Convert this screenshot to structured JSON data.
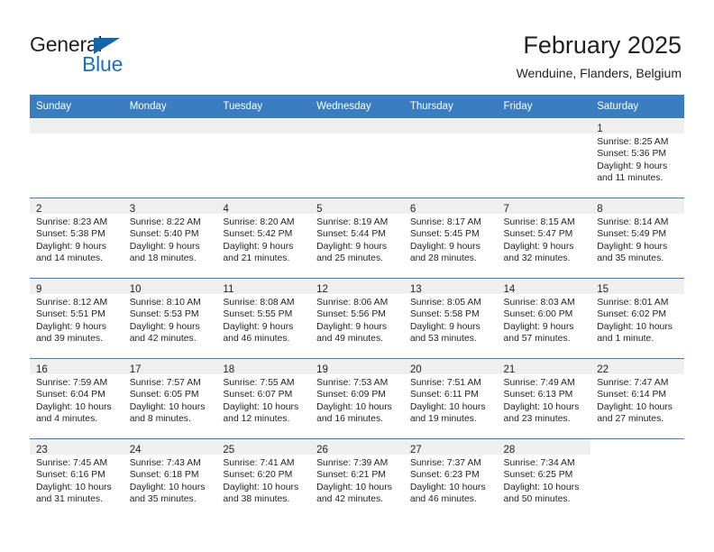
{
  "brand": {
    "name_part1": "General",
    "name_part2": "Blue",
    "color_dark": "#231f20",
    "color_blue": "#1f6fc0"
  },
  "header": {
    "title": "February 2025",
    "subtitle": "Wenduine, Flanders, Belgium"
  },
  "calendar": {
    "header_color": "#3a7dc0",
    "daynum_band_color": "#efefef",
    "weekdays": [
      "Sunday",
      "Monday",
      "Tuesday",
      "Wednesday",
      "Thursday",
      "Friday",
      "Saturday"
    ],
    "weeks": [
      [
        {
          "day": "",
          "blank": true
        },
        {
          "day": "",
          "blank": true
        },
        {
          "day": "",
          "blank": true
        },
        {
          "day": "",
          "blank": true
        },
        {
          "day": "",
          "blank": true
        },
        {
          "day": "",
          "blank": true
        },
        {
          "day": "1",
          "sunrise": "Sunrise: 8:25 AM",
          "sunset": "Sunset: 5:36 PM",
          "daylight": "Daylight: 9 hours and 11 minutes."
        }
      ],
      [
        {
          "day": "2",
          "sunrise": "Sunrise: 8:23 AM",
          "sunset": "Sunset: 5:38 PM",
          "daylight": "Daylight: 9 hours and 14 minutes."
        },
        {
          "day": "3",
          "sunrise": "Sunrise: 8:22 AM",
          "sunset": "Sunset: 5:40 PM",
          "daylight": "Daylight: 9 hours and 18 minutes."
        },
        {
          "day": "4",
          "sunrise": "Sunrise: 8:20 AM",
          "sunset": "Sunset: 5:42 PM",
          "daylight": "Daylight: 9 hours and 21 minutes."
        },
        {
          "day": "5",
          "sunrise": "Sunrise: 8:19 AM",
          "sunset": "Sunset: 5:44 PM",
          "daylight": "Daylight: 9 hours and 25 minutes."
        },
        {
          "day": "6",
          "sunrise": "Sunrise: 8:17 AM",
          "sunset": "Sunset: 5:45 PM",
          "daylight": "Daylight: 9 hours and 28 minutes."
        },
        {
          "day": "7",
          "sunrise": "Sunrise: 8:15 AM",
          "sunset": "Sunset: 5:47 PM",
          "daylight": "Daylight: 9 hours and 32 minutes."
        },
        {
          "day": "8",
          "sunrise": "Sunrise: 8:14 AM",
          "sunset": "Sunset: 5:49 PM",
          "daylight": "Daylight: 9 hours and 35 minutes."
        }
      ],
      [
        {
          "day": "9",
          "sunrise": "Sunrise: 8:12 AM",
          "sunset": "Sunset: 5:51 PM",
          "daylight": "Daylight: 9 hours and 39 minutes."
        },
        {
          "day": "10",
          "sunrise": "Sunrise: 8:10 AM",
          "sunset": "Sunset: 5:53 PM",
          "daylight": "Daylight: 9 hours and 42 minutes."
        },
        {
          "day": "11",
          "sunrise": "Sunrise: 8:08 AM",
          "sunset": "Sunset: 5:55 PM",
          "daylight": "Daylight: 9 hours and 46 minutes."
        },
        {
          "day": "12",
          "sunrise": "Sunrise: 8:06 AM",
          "sunset": "Sunset: 5:56 PM",
          "daylight": "Daylight: 9 hours and 49 minutes."
        },
        {
          "day": "13",
          "sunrise": "Sunrise: 8:05 AM",
          "sunset": "Sunset: 5:58 PM",
          "daylight": "Daylight: 9 hours and 53 minutes."
        },
        {
          "day": "14",
          "sunrise": "Sunrise: 8:03 AM",
          "sunset": "Sunset: 6:00 PM",
          "daylight": "Daylight: 9 hours and 57 minutes."
        },
        {
          "day": "15",
          "sunrise": "Sunrise: 8:01 AM",
          "sunset": "Sunset: 6:02 PM",
          "daylight": "Daylight: 10 hours and 1 minute."
        }
      ],
      [
        {
          "day": "16",
          "sunrise": "Sunrise: 7:59 AM",
          "sunset": "Sunset: 6:04 PM",
          "daylight": "Daylight: 10 hours and 4 minutes."
        },
        {
          "day": "17",
          "sunrise": "Sunrise: 7:57 AM",
          "sunset": "Sunset: 6:05 PM",
          "daylight": "Daylight: 10 hours and 8 minutes."
        },
        {
          "day": "18",
          "sunrise": "Sunrise: 7:55 AM",
          "sunset": "Sunset: 6:07 PM",
          "daylight": "Daylight: 10 hours and 12 minutes."
        },
        {
          "day": "19",
          "sunrise": "Sunrise: 7:53 AM",
          "sunset": "Sunset: 6:09 PM",
          "daylight": "Daylight: 10 hours and 16 minutes."
        },
        {
          "day": "20",
          "sunrise": "Sunrise: 7:51 AM",
          "sunset": "Sunset: 6:11 PM",
          "daylight": "Daylight: 10 hours and 19 minutes."
        },
        {
          "day": "21",
          "sunrise": "Sunrise: 7:49 AM",
          "sunset": "Sunset: 6:13 PM",
          "daylight": "Daylight: 10 hours and 23 minutes."
        },
        {
          "day": "22",
          "sunrise": "Sunrise: 7:47 AM",
          "sunset": "Sunset: 6:14 PM",
          "daylight": "Daylight: 10 hours and 27 minutes."
        }
      ],
      [
        {
          "day": "23",
          "sunrise": "Sunrise: 7:45 AM",
          "sunset": "Sunset: 6:16 PM",
          "daylight": "Daylight: 10 hours and 31 minutes."
        },
        {
          "day": "24",
          "sunrise": "Sunrise: 7:43 AM",
          "sunset": "Sunset: 6:18 PM",
          "daylight": "Daylight: 10 hours and 35 minutes."
        },
        {
          "day": "25",
          "sunrise": "Sunrise: 7:41 AM",
          "sunset": "Sunset: 6:20 PM",
          "daylight": "Daylight: 10 hours and 38 minutes."
        },
        {
          "day": "26",
          "sunrise": "Sunrise: 7:39 AM",
          "sunset": "Sunset: 6:21 PM",
          "daylight": "Daylight: 10 hours and 42 minutes."
        },
        {
          "day": "27",
          "sunrise": "Sunrise: 7:37 AM",
          "sunset": "Sunset: 6:23 PM",
          "daylight": "Daylight: 10 hours and 46 minutes."
        },
        {
          "day": "28",
          "sunrise": "Sunrise: 7:34 AM",
          "sunset": "Sunset: 6:25 PM",
          "daylight": "Daylight: 10 hours and 50 minutes."
        },
        {
          "day": "",
          "blank": true,
          "trailing": true
        }
      ]
    ]
  }
}
